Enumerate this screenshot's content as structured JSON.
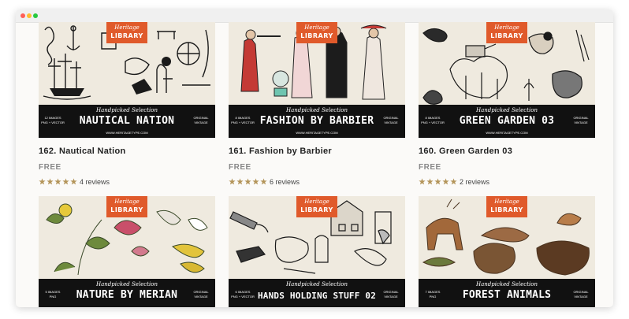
{
  "window": {
    "controls": [
      "close",
      "minimize",
      "maximize"
    ]
  },
  "badge": {
    "line1": "Heritage",
    "line2": "LIBRARY"
  },
  "colors": {
    "badge": "#e05a2b",
    "band": "#111111",
    "star": "#b4955a",
    "thumb_bg": "#efeadf"
  },
  "cards": [
    {
      "title_art": "NAUTICAL NATION",
      "subtitle": "Handpicked Selection",
      "left_info": [
        "12 IMAGES",
        "PNG + VECTOR"
      ],
      "right_info": [
        "ORIGINAL",
        "VINTAGE"
      ],
      "url": "WWW.HERITAGETYPE.COM",
      "name": "162. Nautical Nation",
      "price": "FREE",
      "rating": 5,
      "reviews": "4 reviews"
    },
    {
      "title_art": "FASHION BY BARBIER",
      "subtitle": "Handpicked Selection",
      "left_info": [
        "8 IMAGES",
        "PNG + VECTOR"
      ],
      "right_info": [
        "ORIGINAL",
        "VINTAGE"
      ],
      "url": "WWW.HERITAGETYPE.COM",
      "name": "161. Fashion by Barbier",
      "price": "FREE",
      "rating": 5,
      "reviews": "6 reviews"
    },
    {
      "title_art": "GREEN GARDEN 03",
      "subtitle": "Handpicked Selection",
      "left_info": [
        "8 IMAGES",
        "PNG + VECTOR"
      ],
      "right_info": [
        "ORIGINAL",
        "VINTAGE"
      ],
      "url": "WWW.HERITAGETYPE.COM",
      "name": "160. Green Garden 03",
      "price": "FREE",
      "rating": 5,
      "reviews": "2 reviews"
    },
    {
      "title_art": "NATURE BY MERIAN",
      "subtitle": "Handpicked Selection",
      "left_info": [
        "5 IMAGES",
        "PNG"
      ],
      "right_info": [
        "ORIGINAL",
        "VINTAGE"
      ]
    },
    {
      "title_art": "HANDS HOLDING STUFF 02",
      "subtitle": "Handpicked Selection",
      "left_info": [
        "6 IMAGES",
        "PNG + VECTOR"
      ],
      "right_info": [
        "ORIGINAL",
        "VINTAGE"
      ]
    },
    {
      "title_art": "FOREST ANIMALS",
      "subtitle": "Handpicked Selection",
      "left_info": [
        "7 IMAGES",
        "PNG"
      ],
      "right_info": [
        "ORIGINAL",
        "VINTAGE"
      ]
    }
  ]
}
